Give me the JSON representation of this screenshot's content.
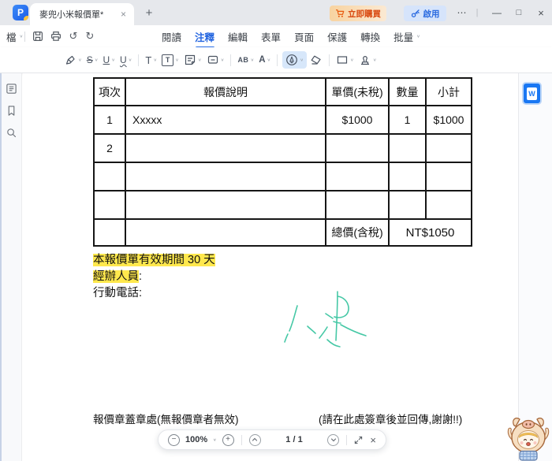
{
  "window": {
    "app_logo": "P",
    "tab_title": "麥兜小米報價單*",
    "tab_close_glyph": "×",
    "new_tab_glyph": "+",
    "buy_label": "立即購買",
    "activate_label": "啟用",
    "more_glyph": "⋯",
    "divider_glyph": "|",
    "minimize_glyph": "—",
    "maximize_glyph": "□",
    "close_glyph": "×"
  },
  "menu": {
    "file_label": "檔",
    "undo_glyph": "↺",
    "redo_glyph": "↻",
    "tabs": [
      "閱讀",
      "注釋",
      "編輯",
      "表單",
      "頁面",
      "保護",
      "轉換",
      "批量"
    ]
  },
  "ribbon": {
    "strike_glyph": "S",
    "underline_glyph": "U",
    "squiggly_glyph": "U",
    "typewriter_glyph": "T",
    "textbox_glyph": "T",
    "replace_glyph": "AB",
    "correction_glyph": "A"
  },
  "quote_table": {
    "headers": [
      "項次",
      "報價說明",
      "單價(未稅)",
      "數量",
      "小計"
    ],
    "rows": [
      [
        "1",
        "Xxxxx",
        "$1000",
        "1",
        "$1000"
      ],
      [
        "2",
        "",
        "",
        "",
        ""
      ],
      [
        "",
        "",
        "",
        "",
        ""
      ],
      [
        "",
        "",
        "",
        "",
        ""
      ]
    ],
    "total_label": "總價(含稅)",
    "total_value": "NT$1050"
  },
  "notes": {
    "validity": "本報價單有效期間 30 天",
    "agent_label": "經辦人員",
    "agent_suffix": ":",
    "phone_label": "行動電話:",
    "stamp_note": "報價章蓋章處(無報價章者無效)",
    "sign_note": "(請在此處簽章後並回傳,謝謝!!)"
  },
  "signature": {
    "text": "小米",
    "color": "#46C8A6"
  },
  "statusbar": {
    "zoom_out_glyph": "−",
    "zoom_level": "100%",
    "zoom_in_glyph": "+",
    "page_indicator": "1 / 1",
    "close_glyph": "×"
  },
  "word_badge": {
    "label": "W"
  },
  "colors": {
    "accent_blue": "#2667E0",
    "buy_orange": "#D9480F",
    "activate_blue": "#2B6BE0",
    "highlight_yellow": "#FFE84D",
    "signature_teal": "#46C8A6",
    "word_blue": "#1977F3"
  }
}
